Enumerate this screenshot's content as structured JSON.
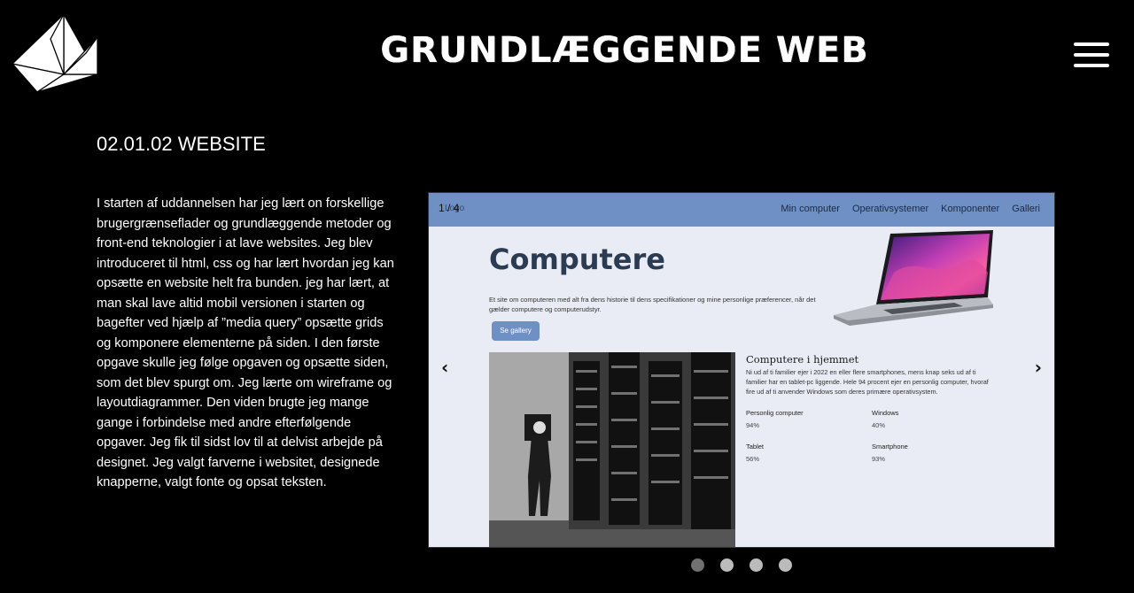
{
  "header": {
    "title": "GRUNDLÆGGENDE WEB",
    "logo_icon": "paper-boat-icon",
    "menu_icon": "hamburger-menu-icon"
  },
  "section": {
    "title": "02.01.02 WEBSITE",
    "body": "I starten af uddannelsen har jeg lært on forskellige brugergrænseflader og grundlæggende metoder og front-end teknologier i at lave websites. Jeg blev introduceret til html, css og har lært hvordan jeg kan opsætte en website helt fra bunden. jeg har lært, at man skal lave altid mobil versionen i starten og bagefter ved hjælp af ”media query” opsætte grids og komponere elementerne på siden. I den første opgave skulle jeg følge opgaven og opsætte siden, som det blev spurgt om. Jeg lærte om wireframe og layoutdiagrammer. Den viden brugte jeg mange gange i forbindelse med andre efterfølgende opgaver. Jeg fik til sidst lov til at delvist arbejde på designet. Jeg valgt farverne i websitet, designede knapperne, valgt fonte og opsat teksten."
  },
  "slideshow": {
    "counter": "1 / 4",
    "prev_arrow": "‹",
    "next_arrow": "›",
    "slide_count": 4,
    "active_index": 0,
    "screenshot": {
      "nav_logo": "Logo",
      "nav_links": [
        "Min computer",
        "Operativsystemer",
        "Komponenter",
        "Galleri"
      ],
      "hero_title": "Computere",
      "hero_description": "Et site om computeren med alt fra dens historie til dens specifikationer og mine personlige præferencer, når det gælder computere og computerudstyr.",
      "button_label": "Se gallery",
      "card_title": "Computere i hjemmet",
      "card_description": "Ni ud af ti familier ejer i 2022 en eller flere smartphones, mens knap seks ud af ti familier har en tablet-pc liggende. Hele 94 procent ejer en personlig computer, hvoraf fire ud af ti anvender Windows som deres primære operativsystem.",
      "stats": [
        {
          "label": "Personlig computer",
          "value": "94%"
        },
        {
          "label": "Windows",
          "value": "40%"
        },
        {
          "label": "Tablet",
          "value": "56%"
        },
        {
          "label": "Smartphone",
          "value": "93%"
        }
      ]
    }
  },
  "colors": {
    "background": "#000000",
    "slide_nav": "#6f90c4",
    "slide_bg": "#e9ecf5",
    "dot_active": "#717171",
    "dot_inactive": "#bbbbbb"
  }
}
